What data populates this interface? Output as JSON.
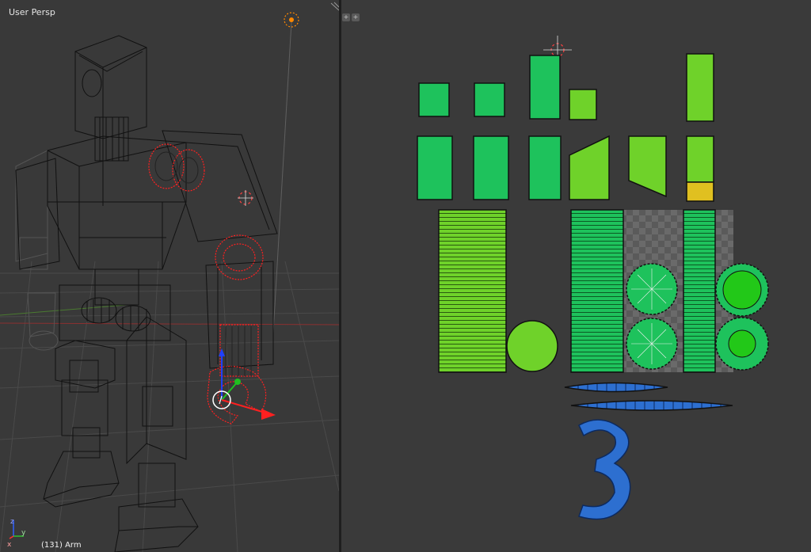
{
  "viewport_3d": {
    "title": "User Persp",
    "status": "(131) Arm",
    "axis_labels": [
      "z",
      "y",
      "x"
    ]
  },
  "uv_editor": {
    "header_buttons": [
      "+",
      "+"
    ]
  },
  "colors": {
    "background": "#393939",
    "wire": "#111111",
    "selected_edge": "#ff2020",
    "uv_green": "#1ec25c",
    "uv_lime": "#6fd22a",
    "uv_blue": "#2d6fd0",
    "uv_yellow": "#e0c020"
  },
  "icons": [
    "3d-cursor-icon",
    "lamp-icon",
    "manipulator-arrow-icon",
    "axis-gizmo-icon",
    "split-handle-icon"
  ]
}
